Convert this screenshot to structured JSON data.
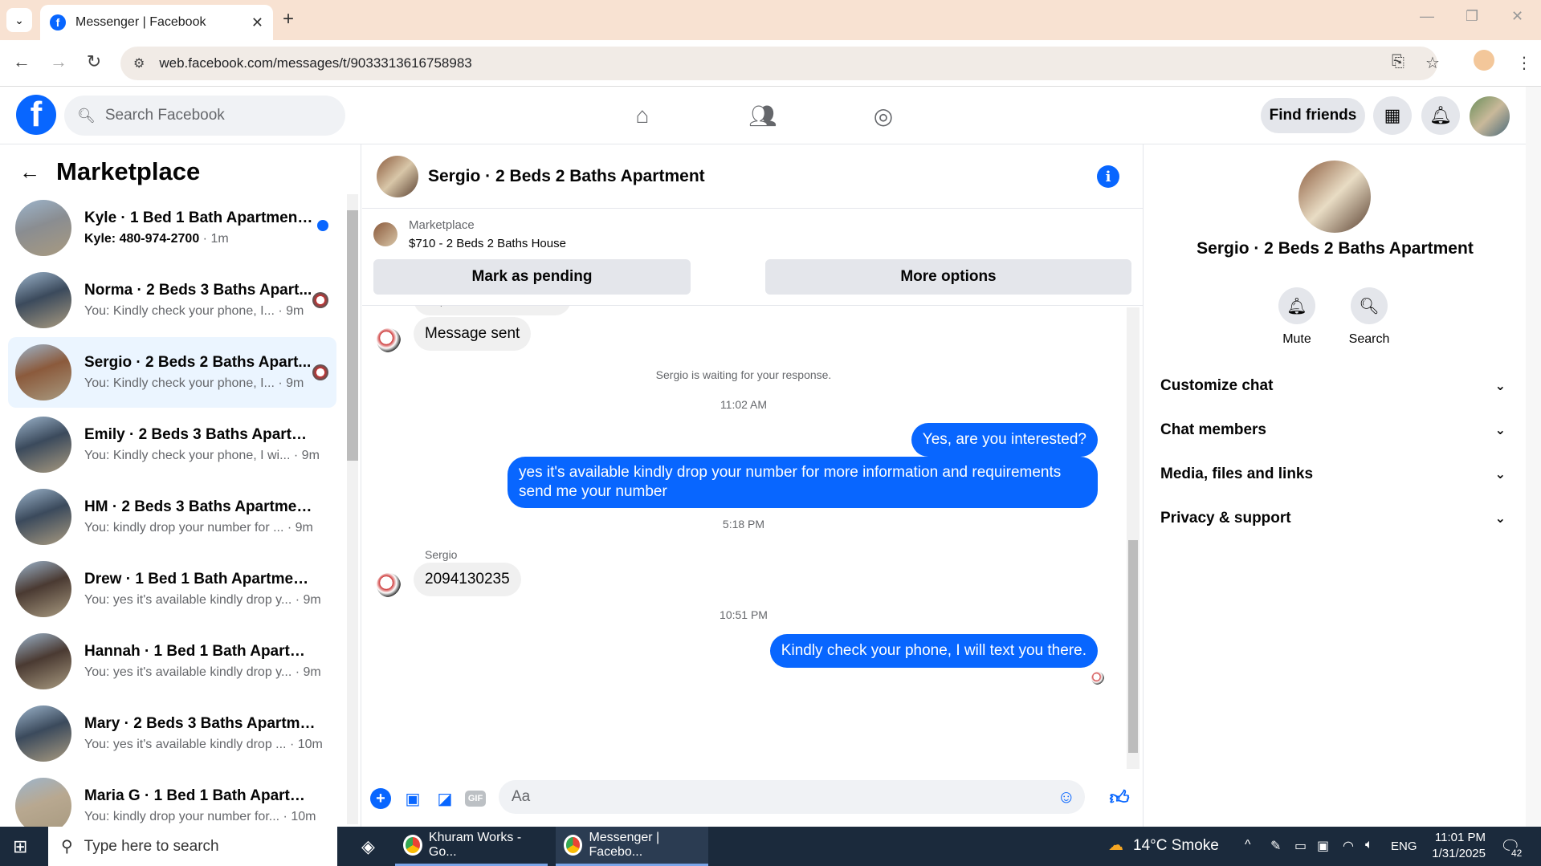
{
  "browser": {
    "tab_title": "Messenger | Facebook",
    "url": "web.facebook.com/messages/t/9033313616758983"
  },
  "fb_header": {
    "logo_letter": "f",
    "search_placeholder": "Search Facebook",
    "find_friends_label": "Find friends"
  },
  "sidebar": {
    "title": "Marketplace",
    "conversations": [
      {
        "name": "Kyle · 1 Bed 1 Bath Apartment/...",
        "preview_bold": "Kyle: 480-974-2700",
        "preview": "",
        "time": " · 1m",
        "unread": true,
        "avatar_color": "#8a8d91"
      },
      {
        "name": "Norma · 2 Beds 3 Baths Apart...",
        "preview_bold": "",
        "preview": "You: Kindly check your phone, I...",
        "time": " · 9m",
        "avatar_color": "#3b4a5c"
      },
      {
        "name": "Sergio · 2 Beds 2 Baths Apart...",
        "preview_bold": "",
        "preview": "You: Kindly check your phone, I...",
        "time": " · 9m",
        "avatar_color": "#8b5a3c"
      },
      {
        "name": "Emily · 2 Beds 3 Baths Apartme...",
        "preview_bold": "",
        "preview": "You: Kindly check your phone, I wi...",
        "time": " · 9m",
        "avatar_color": "#3b4a5c"
      },
      {
        "name": "HM · 2 Beds 3 Baths Apartment...",
        "preview_bold": "",
        "preview": "You: kindly drop your number for ...",
        "time": " · 9m",
        "avatar_color": "#3b4a5c"
      },
      {
        "name": "Drew · 1 Bed 1 Bath Apartment/...",
        "preview_bold": "",
        "preview": "You: yes it's available kindly drop y...",
        "time": " · 9m",
        "avatar_color": "#4a3a32"
      },
      {
        "name": "Hannah · 1 Bed 1 Bath Apartmen...",
        "preview_bold": "",
        "preview": "You: yes it's available kindly drop y...",
        "time": " · 9m",
        "avatar_color": "#4a3a32"
      },
      {
        "name": "Mary · 2 Beds 3 Baths Apartmen...",
        "preview_bold": "",
        "preview": "You: yes it's available kindly drop ...",
        "time": " · 10m",
        "avatar_color": "#3b4a5c"
      },
      {
        "name": "Maria G · 1 Bed 1 Bath Apartme...",
        "preview_bold": "",
        "preview": "You: kindly drop your number for...",
        "time": " · 10m",
        "avatar_color": "#b8a890"
      }
    ]
  },
  "chat": {
    "title": "Sergio · 2 Beds 2 Baths Apartment",
    "marketplace_label": "Marketplace",
    "listing": "$710 - 2 Beds 2 Baths House",
    "mark_pending": "Mark as pending",
    "more_options": "More options",
    "clipped_text": "Hi, is this available?",
    "message_sent": "Message sent",
    "waiting_note": "Sergio is waiting for your response.",
    "time1": "11:02 AM",
    "out1": "Yes, are you interested?",
    "out2": "yes it's available kindly drop your number for more information and requirements send me your number",
    "time2": "5:18 PM",
    "sender_name": "Sergio",
    "in_phone": "2094130235",
    "time3": "10:51 PM",
    "out3": "Kindly check your phone, I will text you there.",
    "composer_placeholder": "Aa"
  },
  "details": {
    "name": "Sergio · 2 Beds 2 Baths Apartment",
    "mute": "Mute",
    "search": "Search",
    "sections": [
      "Customize chat",
      "Chat members",
      "Media, files and links",
      "Privacy & support"
    ]
  },
  "taskbar": {
    "search_placeholder": "Type here to search",
    "app1": "Khuram Works - Go...",
    "app2": "Messenger | Facebo...",
    "weather": "14°C  Smoke",
    "lang": "ENG",
    "time": "11:01 PM",
    "date": "1/31/2025",
    "notif_count": "42"
  },
  "colors": {
    "brand": "#0866ff",
    "active_conv": "#ebf5ff"
  }
}
